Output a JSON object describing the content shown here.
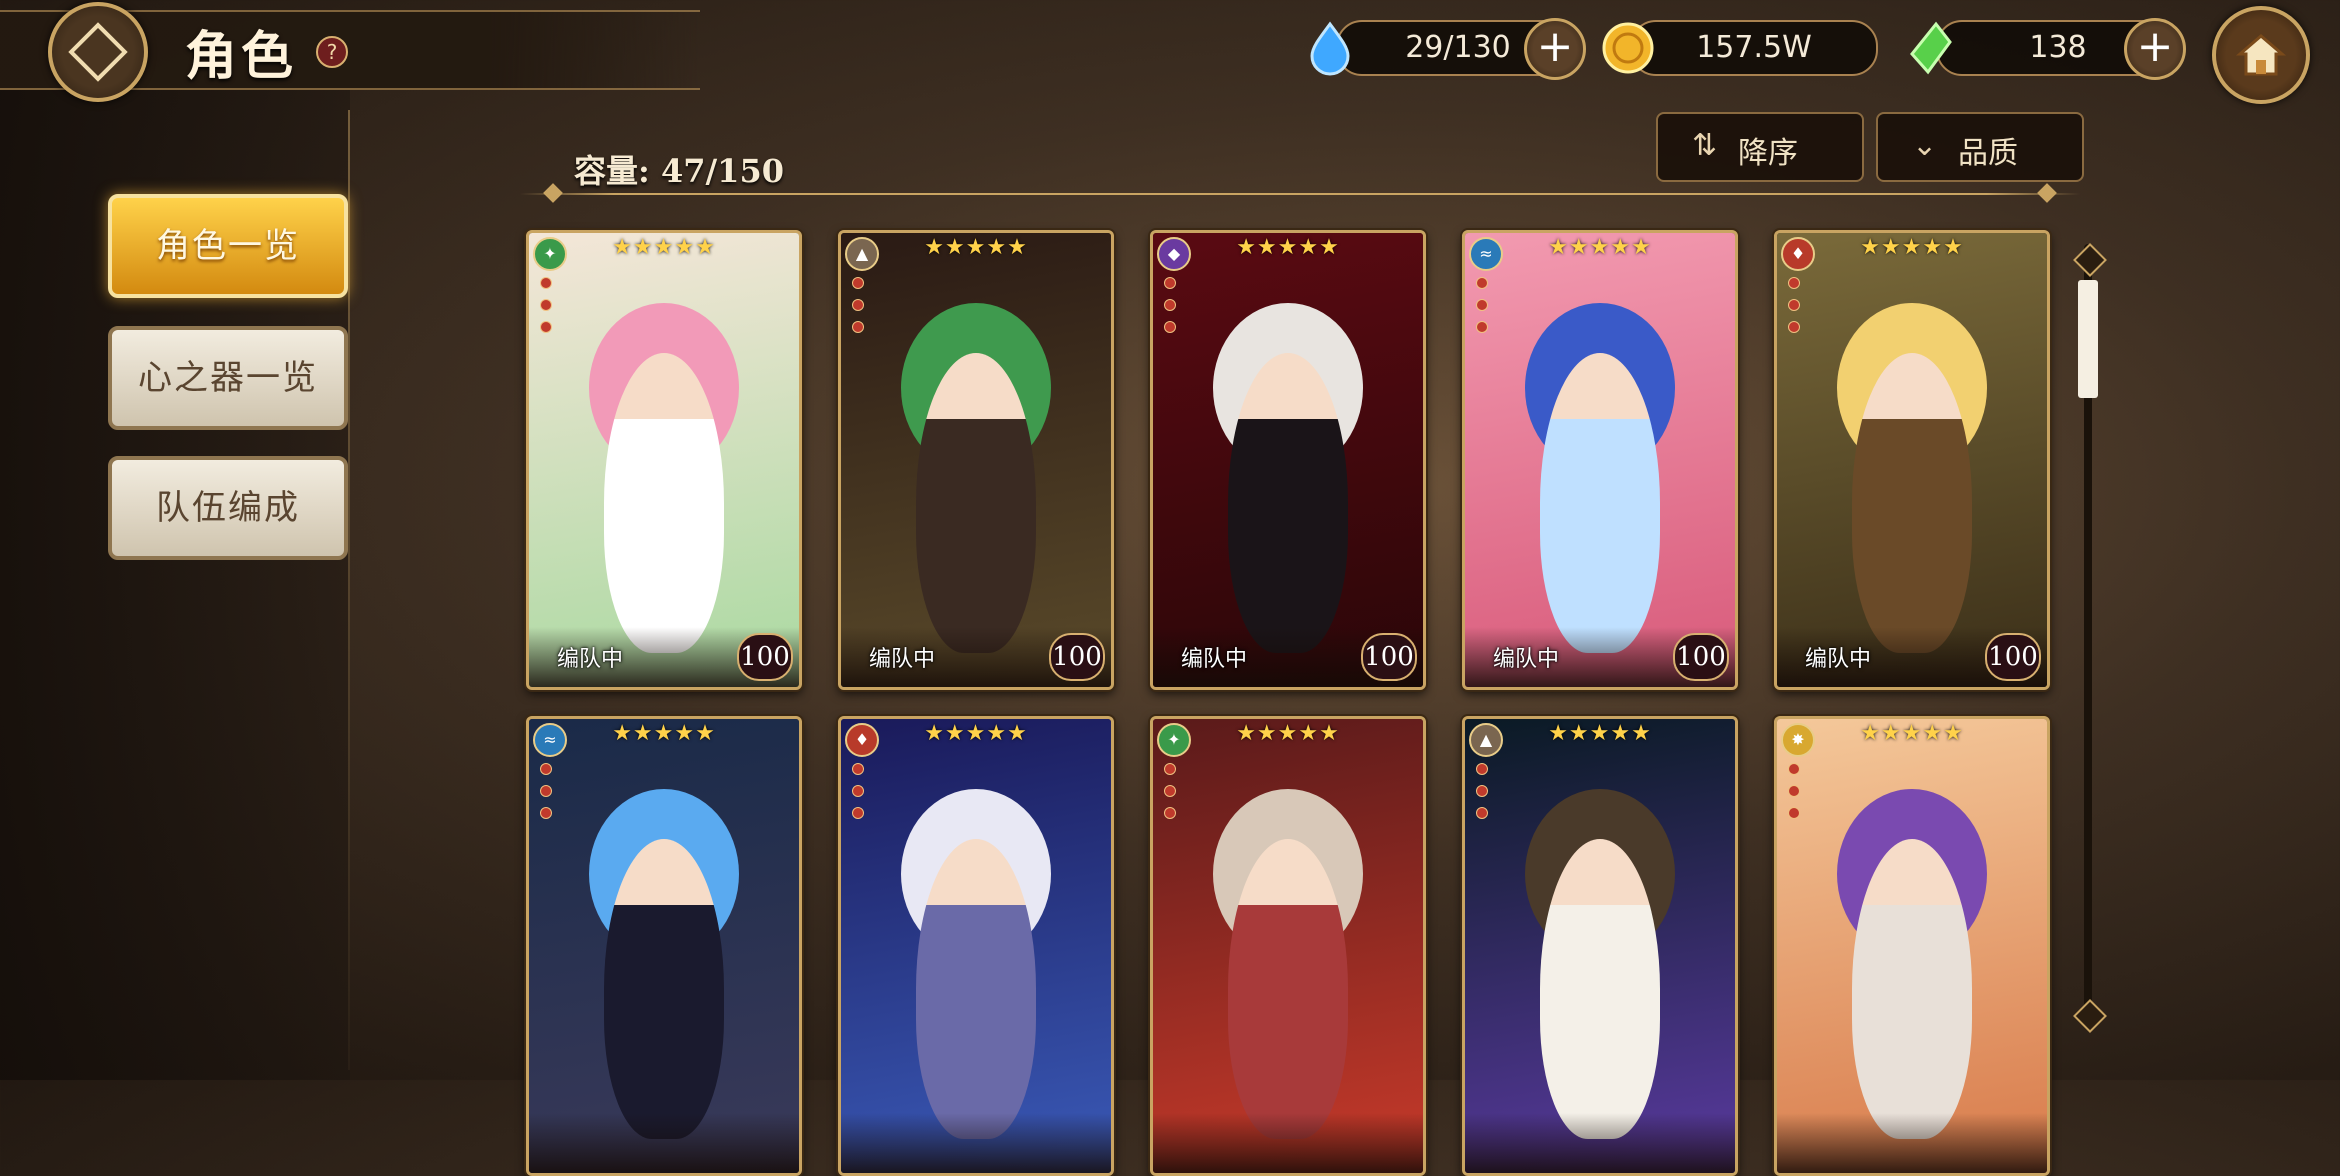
{
  "header": {
    "title": "角色",
    "help_symbol": "?"
  },
  "resources": [
    {
      "name": "stamina",
      "icon": "water-drop-icon",
      "value": "29/130",
      "color": "#3fa8ff"
    },
    {
      "name": "gold",
      "icon": "gold-coin-icon",
      "value": "157.5W",
      "color": "#f2b52a"
    },
    {
      "name": "gem",
      "icon": "green-crystal-icon",
      "value": "138",
      "color": "#58d04a"
    }
  ],
  "plus_symbol": "+",
  "sort": {
    "order_label": "降序",
    "order_icon": "⇅",
    "quality_label": "品质",
    "quality_icon": "⌄"
  },
  "capacity": "容量: 47/150",
  "menu": [
    {
      "label": "角色一览",
      "active": true
    },
    {
      "label": "心之器一览",
      "active": false
    },
    {
      "label": "队伍编成",
      "active": false
    }
  ],
  "cards": [
    {
      "stars": "★★★★★",
      "element": "wind",
      "status": "编队中",
      "level": "100",
      "elem_color": "#3a9a4a",
      "bg": [
        "#f4e6d8",
        "#a9d9a0"
      ],
      "hair": "#f29ab8",
      "outfit": "#ffffff"
    },
    {
      "stars": "★★★★★",
      "element": "earth",
      "status": "编队中",
      "level": "100",
      "elem_color": "#7a6650",
      "bg": [
        "#2a1a14",
        "#5a4a2a"
      ],
      "hair": "#3f9a4e",
      "outfit": "#3a2a22"
    },
    {
      "stars": "★★★★★",
      "element": "dark",
      "status": "编队中",
      "level": "100",
      "elem_color": "#6a3aa0",
      "bg": [
        "#5a0a12",
        "#2a0608"
      ],
      "hair": "#e8e4e0",
      "outfit": "#1a1418"
    },
    {
      "stars": "★★★★★",
      "element": "water",
      "status": "编队中",
      "level": "100",
      "elem_color": "#2a7ab8",
      "bg": [
        "#f29ab0",
        "#d85a7a"
      ],
      "hair": "#3a5ac8",
      "outfit": "#bfe0ff"
    },
    {
      "stars": "★★★★★",
      "element": "fire",
      "status": "编队中",
      "level": "100",
      "elem_color": "#b83a2a",
      "bg": [
        "#7a6a3a",
        "#3a2e18"
      ],
      "hair": "#f2d070",
      "outfit": "#6a4a28"
    },
    {
      "stars": "★★★★★",
      "element": "water",
      "status": "",
      "level": "",
      "elem_color": "#2a7ab8",
      "bg": [
        "#1a2a48",
        "#3a3a5a"
      ],
      "hair": "#5aaaf0",
      "outfit": "#1a1a2e"
    },
    {
      "stars": "★★★★★",
      "element": "fire",
      "status": "",
      "level": "",
      "elem_color": "#b83a2a",
      "bg": [
        "#1a1a5a",
        "#3a5ab8"
      ],
      "hair": "#e8e8f4",
      "outfit": "#6a6aa8"
    },
    {
      "stars": "★★★★★",
      "element": "wind",
      "status": "",
      "level": "",
      "elem_color": "#3a9a4a",
      "bg": [
        "#5a1a1a",
        "#c83a2a"
      ],
      "hair": "#d8c8b8",
      "outfit": "#a83a3a"
    },
    {
      "stars": "★★★★★",
      "element": "earth",
      "status": "",
      "level": "",
      "elem_color": "#7a6650",
      "bg": [
        "#0a1a24",
        "#5a3aa0"
      ],
      "hair": "#4a3a2a",
      "outfit": "#f4f0e8"
    },
    {
      "stars": "★★★★★",
      "element": "light",
      "status": "",
      "level": "",
      "elem_color": "#d8a830",
      "bg": [
        "#f4c89a",
        "#d87a4a"
      ],
      "hair": "#7a4ab0",
      "outfit": "#e8e0d8"
    }
  ]
}
